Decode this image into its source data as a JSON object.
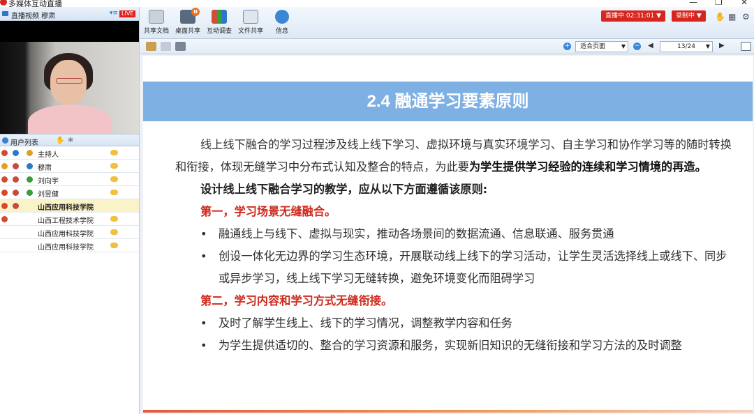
{
  "window": {
    "title": "多媒体互动直播"
  },
  "video": {
    "title": "直播视频 穆肃",
    "live_badge": "LIVE"
  },
  "users": {
    "title": "用户列表",
    "rows": [
      {
        "name": "主持人",
        "bold": false
      },
      {
        "name": "穆肃",
        "bold": false
      },
      {
        "name": "刘向宇",
        "bold": false
      },
      {
        "name": "刘昱健",
        "bold": false
      },
      {
        "name": "山西应用科技学院",
        "bold": true
      },
      {
        "name": "山西工程技术学院",
        "bold": false
      },
      {
        "name": "山西应用科技学院",
        "bold": false
      },
      {
        "name": "山西应用科技学院",
        "bold": false
      }
    ]
  },
  "toolbar": {
    "share_doc": "共享文档",
    "desktop_share": "桌面共享",
    "survey": "互动调查",
    "file_share": "文件共享",
    "info": "信息",
    "new_badge": "N",
    "live_status": "直播中 02:31:01 ▼",
    "rec_status": "录制中 ▼"
  },
  "doc": {
    "fit_option": "适合页面",
    "page_indicator": "13/24"
  },
  "slide": {
    "title": "2.4 融通学习要素原则",
    "para_a": "线上线下融合的学习过程涉及线上线下学习、虚拟环境与真实环境学习、自主学习和协作学习等的随时转换和衔接，体现无缝学习中分布式认知及整合的特点，为此要",
    "para_b": "为学生提供学习经验的连续和学习情境的再造。",
    "subhead": "设计线上线下融合学习的教学，应从以下方面遵循该原则:",
    "point1": "第一，学习场景无缝融合。",
    "bullet1": "融通线上与线下、虚拟与现实，推动各场景间的数据流通、信息联通、服务贯通",
    "bullet2": "创设一体化无边界的学习生态环境，开展联动线上线下的学习活动，让学生灵活选择线上或线下、同步或异步学习，线上线下学习无缝转换，避免环境变化而阻碍学习",
    "point2": "第二，学习内容和学习方式无缝衔接。",
    "bullet3": "及时了解学生线上、线下的学习情况，调整教学内容和任务",
    "bullet4": "为学生提供适切的、整合的学习资源和服务，实现新旧知识的无缝衔接和学习方法的及时调整",
    "bullet_char": "•"
  }
}
